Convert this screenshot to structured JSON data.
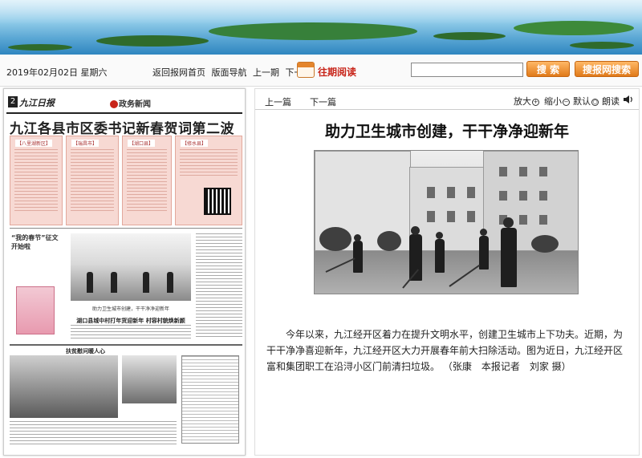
{
  "toolbar": {
    "date": "2019年02月02日 星期六",
    "nav_home": "返回报网首页",
    "nav_guide": "版面导航",
    "nav_prev": "上一期",
    "nav_next": "下一期",
    "past_reading": "往期阅读",
    "search_value": "",
    "search_button": "搜 索",
    "site_search_button": "搜报网搜索"
  },
  "newspaper": {
    "page_number": "2",
    "logo": "九江日报",
    "section": "政务新闻",
    "headline": "九江各县市区委书记新春贺词第二波",
    "pink_labels": [
      "【八里湖新区】",
      "【瑞昌市】",
      "【湖口县】",
      "【修水县】"
    ],
    "sidebar_title": "“我的春节”征文开始啦",
    "photo_caption": "助力卫生城市创建，干干净净迎新年",
    "subhead": "湖口县城中村打年货迎新年 村容村貌焕新颜",
    "bottom_head": "扶贫慰问暖人心"
  },
  "article": {
    "prev": "上一篇",
    "next": "下一篇",
    "zoom_in": "放大",
    "zoom_out": "缩小",
    "default": "默认",
    "read_aloud": "朗读",
    "title": "助力卫生城市创建，干干净净迎新年",
    "body": "今年以来，九江经开区着力在提升文明水平，创建卫生城市上下功夫。近期，为干干净净喜迎新年，九江经开区大力开展春年前大扫除活动。图为近日，九江经开区富和集团职工在沿浔小区门前清扫垃圾。 （张康　本报记者　刘家 摄）"
  },
  "colors": {
    "accent_orange": "#e07a1a",
    "past_reading_red": "#c8251a",
    "pink_box": "#f7d9d3"
  }
}
